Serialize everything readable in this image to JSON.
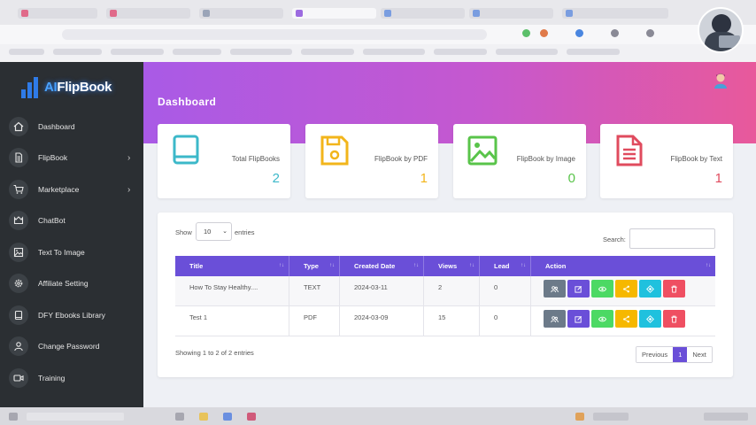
{
  "sidebar": {
    "logo_prefix": "AI",
    "logo_suffix": "FlipBook",
    "items": [
      {
        "label": "Dashboard",
        "icon": "home-icon",
        "chevron": ""
      },
      {
        "label": "FlipBook",
        "icon": "document-icon",
        "chevron": "›"
      },
      {
        "label": "Marketplace",
        "icon": "cart-icon",
        "chevron": "›"
      },
      {
        "label": "ChatBot",
        "icon": "chatbot-icon",
        "chevron": ""
      },
      {
        "label": "Text To Image",
        "icon": "image-icon",
        "chevron": ""
      },
      {
        "label": "Affiliate Setting",
        "icon": "gear-icon",
        "chevron": ""
      },
      {
        "label": "DFY Ebooks Library",
        "icon": "book-icon",
        "chevron": ""
      },
      {
        "label": "Change Password",
        "icon": "user-icon",
        "chevron": ""
      },
      {
        "label": "Training",
        "icon": "video-icon",
        "chevron": ""
      }
    ]
  },
  "header": {
    "title": "Dashboard"
  },
  "cards": [
    {
      "label": "Total FlipBooks",
      "value": "2",
      "color": "#3cb8c9",
      "icon": "book-icon"
    },
    {
      "label": "FlipBook by PDF",
      "value": "1",
      "color": "#f2b51b",
      "icon": "save-icon"
    },
    {
      "label": "FlipBook by Image",
      "value": "0",
      "color": "#59c44a",
      "icon": "image-icon"
    },
    {
      "label": "FlipBook by Text",
      "value": "1",
      "color": "#e04b5e",
      "icon": "text-file-icon"
    }
  ],
  "table_controls": {
    "show_label": "Show",
    "entries_value": "10",
    "entries_label": "entries",
    "search_label": "Search:"
  },
  "table": {
    "headers": [
      "Title",
      "Type",
      "Created Date",
      "Views",
      "Lead",
      "Action"
    ],
    "rows": [
      {
        "title": "How To Stay Healthy....",
        "type": "TEXT",
        "date": "2024-03-11",
        "views": "2",
        "lead": "0"
      },
      {
        "title": "Test 1",
        "type": "PDF",
        "date": "2024-03-09",
        "views": "15",
        "lead": "0"
      }
    ],
    "actions": [
      {
        "name": "leads",
        "color": "#6c7a89",
        "icon": "users-icon"
      },
      {
        "name": "edit",
        "color": "#6a4fd8",
        "icon": "edit-icon"
      },
      {
        "name": "view",
        "color": "#4cd964",
        "icon": "eye-icon"
      },
      {
        "name": "share",
        "color": "#f6b800",
        "icon": "share-icon"
      },
      {
        "name": "embed",
        "color": "#1fc1de",
        "icon": "embed-icon"
      },
      {
        "name": "delete",
        "color": "#ef4f62",
        "icon": "trash-icon"
      }
    ]
  },
  "footer": {
    "info": "Showing 1 to 2 of 2 entries",
    "pager": {
      "previous": "Previous",
      "current": "1",
      "next": "Next"
    }
  },
  "colors": {
    "sidebar_bg": "#2b2f33",
    "hero_gradient": [
      "#a95ae6",
      "#e8599b"
    ],
    "table_header": "#6a4fd8"
  }
}
